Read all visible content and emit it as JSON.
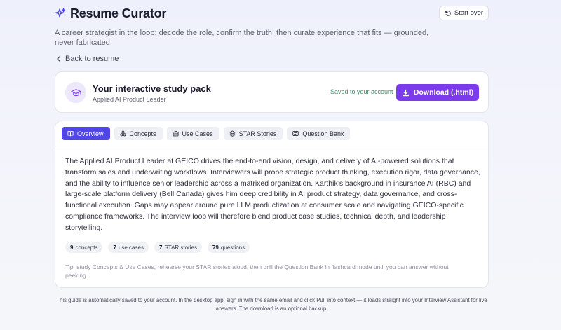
{
  "header": {
    "title": "Resume Curator",
    "subtitle": "A career strategist in the loop: decode the role, confirm the truth, then curate experience that fits — grounded, never fabricated.",
    "start_over_label": "Start over"
  },
  "nav": {
    "back_label": "Back to resume"
  },
  "study_pack": {
    "title": "Your interactive study pack",
    "role": "Applied AI Product Leader",
    "saved_status": "Saved to your account",
    "download_label": "Download (.html)",
    "accent_color": "#7c3aed"
  },
  "tabs": [
    {
      "label": "Overview",
      "icon": "book-icon",
      "active": true
    },
    {
      "label": "Concepts",
      "icon": "shapes-icon",
      "active": false
    },
    {
      "label": "Use Cases",
      "icon": "briefcase-icon",
      "active": false
    },
    {
      "label": "STAR Stories",
      "icon": "layers-icon",
      "active": false
    },
    {
      "label": "Question Bank",
      "icon": "card-icon",
      "active": false
    }
  ],
  "overview": {
    "text": "The Applied AI Product Leader at GEICO drives the end-to-end vision, design, and delivery of AI-powered solutions that transform sales and underwriting workflows. Interviewers will probe strategic product thinking, execution rigor, data governance, and the ability to influence senior leadership across a matrixed organization. Karthik’s background in insurance AI (RBC) and large-scale platform delivery (Bell Canada) gives him deep credibility in AI product strategy, data governance, and cross-functional execution. Gaps may appear around pure LLM productization at consumer scale and navigating GEICO-specific compliance frameworks. The interview loop will therefore blend product case studies, technical depth, and leadership storytelling.",
    "stats": [
      {
        "count": "9",
        "label": "concepts"
      },
      {
        "count": "7",
        "label": "use cases"
      },
      {
        "count": "7",
        "label": "STAR stories"
      },
      {
        "count": "79",
        "label": "questions"
      }
    ],
    "tip": "Tip: study Concepts & Use Cases, rehearse your STAR stories aloud, then drill the Question Bank in flashcard mode until you can answer without peeking."
  },
  "footer": {
    "note": "This guide is automatically saved to your account. In the desktop app, sign in with the same email and click Pull into context — it loads straight into your Interview Assistant for live answers. The download is an optional backup."
  },
  "colors": {
    "active_tab": "#4f46e5",
    "download_button": "#7c3aed",
    "saved_text": "#3f8e6a"
  }
}
